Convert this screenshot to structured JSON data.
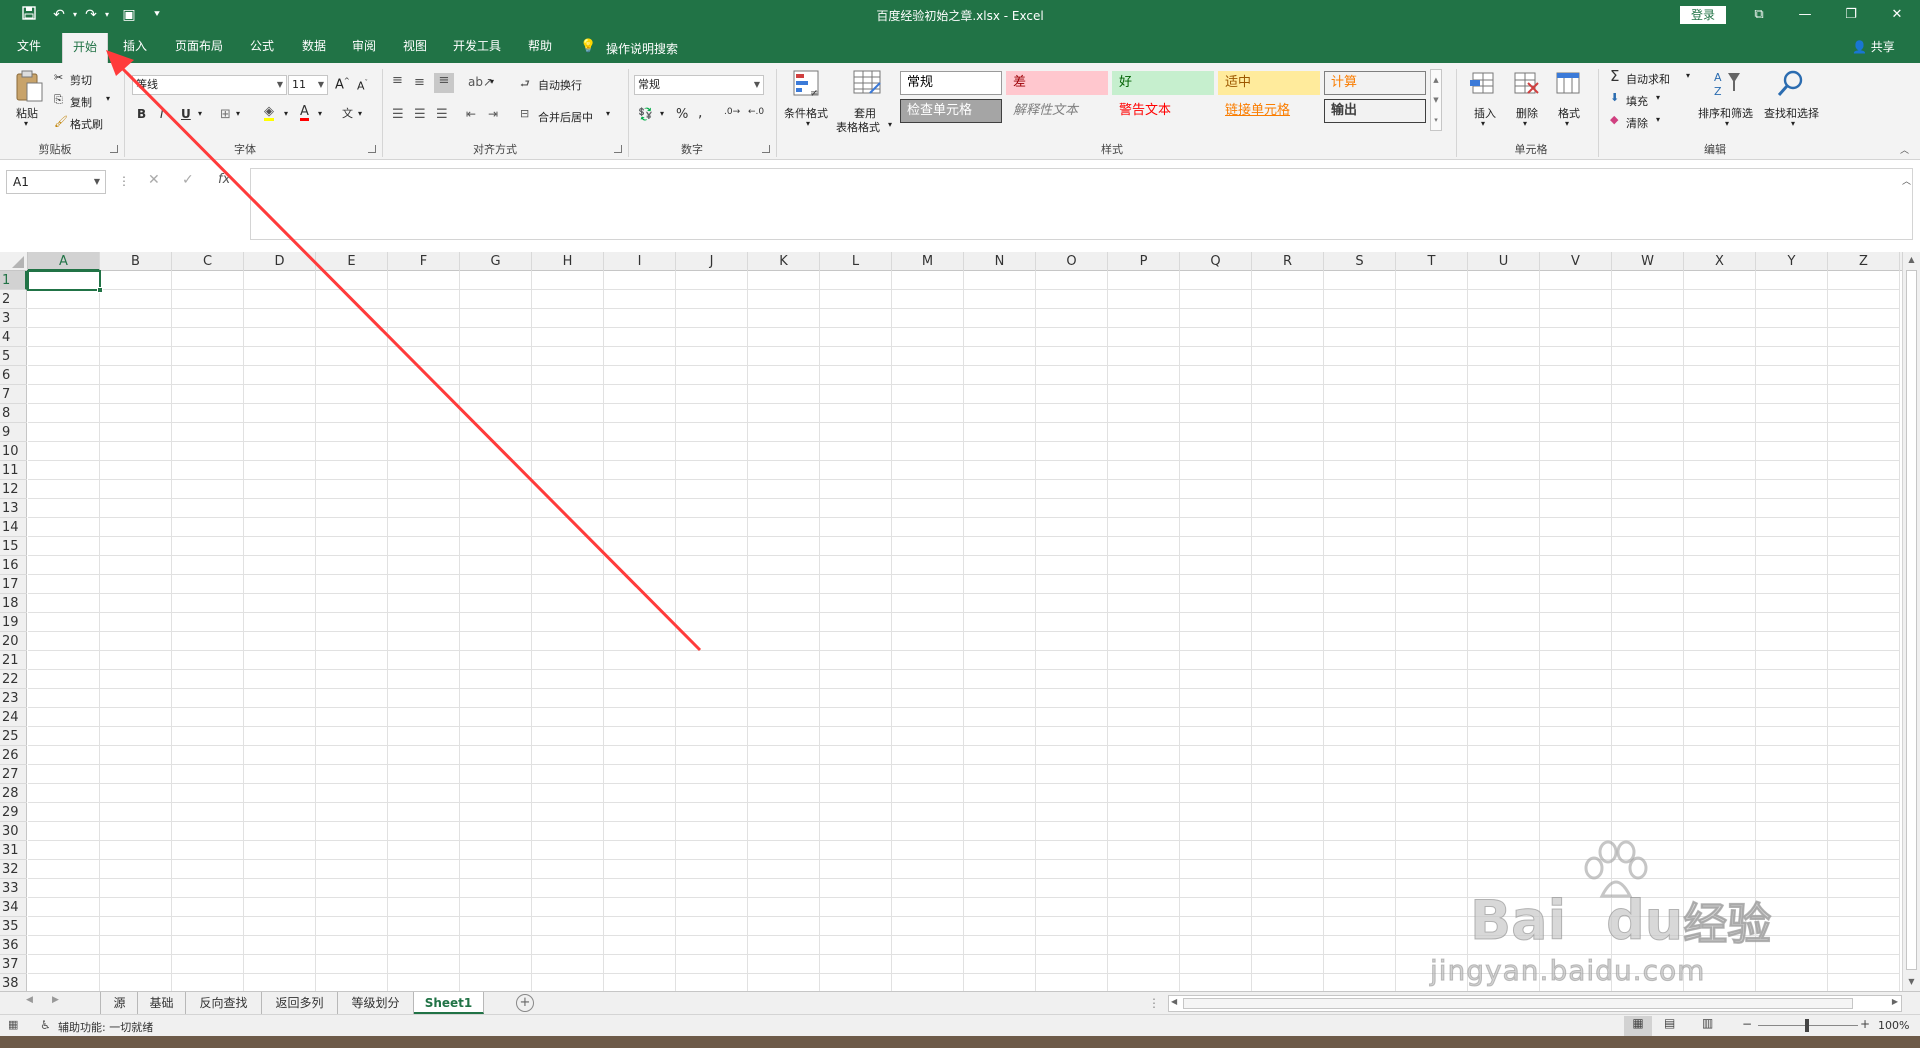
{
  "window": {
    "title": "百度经验初始之章.xlsx - Excel",
    "login_label": "登录",
    "share_label": "共享",
    "controls": [
      "restore-ribbon",
      "minimize",
      "maximize",
      "close"
    ]
  },
  "tabs": [
    {
      "label": "文件",
      "active": false
    },
    {
      "label": "开始",
      "active": true
    },
    {
      "label": "插入",
      "active": false
    },
    {
      "label": "页面布局",
      "active": false
    },
    {
      "label": "公式",
      "active": false
    },
    {
      "label": "数据",
      "active": false
    },
    {
      "label": "审阅",
      "active": false
    },
    {
      "label": "视图",
      "active": false
    },
    {
      "label": "开发工具",
      "active": false
    },
    {
      "label": "帮助",
      "active": false
    }
  ],
  "tell_me": "操作说明搜索",
  "ribbon": {
    "clipboard": {
      "group": "剪贴板",
      "paste": "粘贴",
      "cut": "剪切",
      "copy": "复制",
      "format_painter": "格式刷"
    },
    "font": {
      "group": "字体",
      "name": "等线",
      "size": "11"
    },
    "alignment": {
      "group": "对齐方式",
      "wrap": "自动换行",
      "merge": "合并后居中"
    },
    "number": {
      "group": "数字",
      "format": "常规"
    },
    "styles": {
      "group": "样式",
      "cond_format": "条件格式",
      "table_format_1": "套用",
      "table_format_2": "表格格式",
      "cells": [
        {
          "label": "常规",
          "bg": "#ffffff",
          "fg": "#000000",
          "border": "#9a9a9a"
        },
        {
          "label": "差",
          "bg": "#ffc7ce",
          "fg": "#9c0006",
          "border": "#ffc7ce"
        },
        {
          "label": "好",
          "bg": "#c6efce",
          "fg": "#006100",
          "border": "#c6efce"
        },
        {
          "label": "适中",
          "bg": "#ffeb9c",
          "fg": "#9c5700",
          "border": "#ffeb9c"
        },
        {
          "label": "计算",
          "bg": "#f2f2f2",
          "fg": "#fa7d00",
          "border": "#7f7f7f"
        },
        {
          "label": "检查单元格",
          "bg": "#a5a5a5",
          "fg": "#ffffff",
          "border": "#3f3f3f"
        },
        {
          "label": "解释性文本",
          "bg": "#f3f3f3",
          "fg": "#7f7f7f",
          "border": "#f3f3f3"
        },
        {
          "label": "警告文本",
          "bg": "#f3f3f3",
          "fg": "#ff0000",
          "border": "#f3f3f3"
        },
        {
          "label": "链接单元格",
          "bg": "#f3f3f3",
          "fg": "#fa7d00",
          "border": "#f3f3f3"
        },
        {
          "label": "输出",
          "bg": "#f2f2f2",
          "fg": "#3f3f3f",
          "border": "#3f3f3f"
        }
      ]
    },
    "cells": {
      "group": "单元格",
      "insert": "插入",
      "delete": "删除",
      "format": "格式"
    },
    "editing": {
      "group": "编辑",
      "autosum": "自动求和",
      "fill": "填充",
      "clear": "清除",
      "sort": "排序和筛选",
      "find": "查找和选择"
    }
  },
  "formula_bar": {
    "name_box": "A1",
    "content": ""
  },
  "grid": {
    "columns": [
      "A",
      "B",
      "C",
      "D",
      "E",
      "F",
      "G",
      "H",
      "I",
      "J",
      "K",
      "L",
      "M",
      "N",
      "O",
      "P",
      "Q",
      "R",
      "S",
      "T",
      "U",
      "V",
      "W",
      "X",
      "Y",
      "Z"
    ],
    "rows": [
      "1",
      "2",
      "3",
      "4",
      "5",
      "6",
      "7",
      "8",
      "9",
      "10",
      "11",
      "12",
      "13",
      "14",
      "15",
      "16",
      "17",
      "18",
      "19",
      "20",
      "21",
      "22",
      "23",
      "24",
      "25",
      "26",
      "27",
      "28",
      "29",
      "30",
      "31",
      "32",
      "33",
      "34",
      "35",
      "36",
      "37",
      "38"
    ],
    "active_cell": "A1"
  },
  "sheets": [
    {
      "label": "源",
      "active": false
    },
    {
      "label": "基础",
      "active": false
    },
    {
      "label": "反向查找",
      "active": false
    },
    {
      "label": "返回多列",
      "active": false
    },
    {
      "label": "等级划分",
      "active": false
    },
    {
      "label": "Sheet1",
      "active": true
    }
  ],
  "status": {
    "accessibility": "辅助功能: 一切就绪",
    "zoom": "100%"
  },
  "watermark": {
    "brand": "Bai",
    "brand2": "du",
    "brand_cn": "经验",
    "url": "jingyan.baidu.com"
  },
  "colors": {
    "excel_green": "#217346",
    "annotation": "#ff3b3b"
  }
}
